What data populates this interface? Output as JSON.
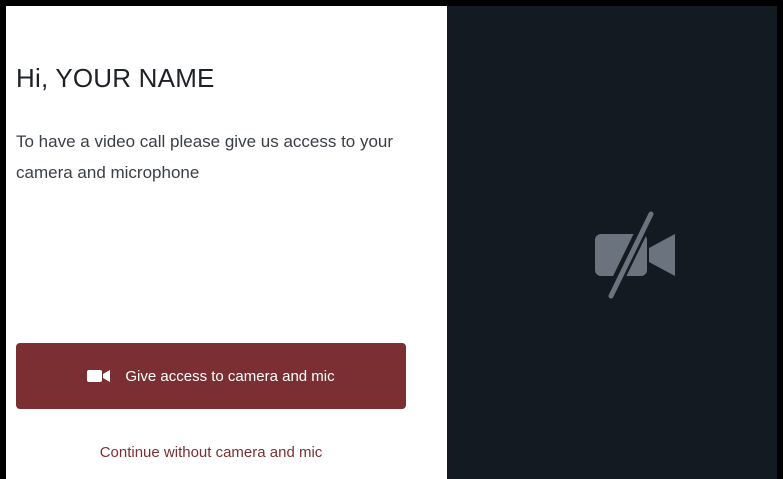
{
  "greeting": "Hi, YOUR NAME",
  "description": "To have a video call please give us access to your camera and microphone",
  "primary_button": {
    "label": "Give access to camera and mic",
    "icon": "video-camera-icon",
    "background_color": "#7b2f32"
  },
  "secondary_link": {
    "label": "Continue without camera and mic",
    "color": "#7b2f32"
  },
  "preview": {
    "icon": "camera-off-icon",
    "background_color": "#141a22"
  }
}
